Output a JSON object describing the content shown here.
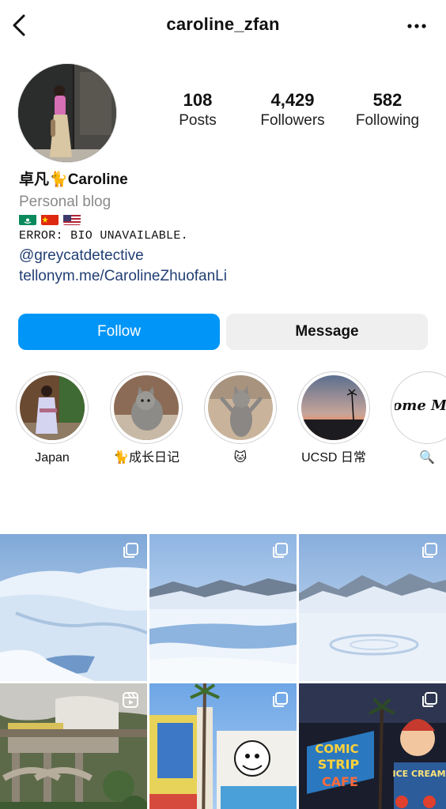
{
  "header": {
    "username": "caroline_zfan",
    "back_icon": "chevron-left-icon",
    "more_icon": "more-horizontal-icon"
  },
  "profile": {
    "stats": [
      {
        "value": "108",
        "label": "Posts"
      },
      {
        "value": "4,429",
        "label": "Followers"
      },
      {
        "value": "582",
        "label": "Following"
      }
    ],
    "display_name_prefix": "卓凡",
    "display_name_emoji": "🐈",
    "display_name_suffix": "Caroline",
    "category": "Personal blog",
    "flags": [
      "macau-flag",
      "china-flag",
      "usa-flag"
    ],
    "bio": "ERROR: BIO UNAVAILABLE.",
    "mention": "@greycatdetective",
    "website": "tellonym.me/CarolineZhuofanLi"
  },
  "actions": {
    "follow_label": "Follow",
    "message_label": "Message",
    "follow_color": "#0095f6"
  },
  "highlights": [
    {
      "label": "Japan"
    },
    {
      "label": "🐈成长日记"
    },
    {
      "label": "🐱"
    },
    {
      "label": "UCSD 日常"
    },
    {
      "label": "🔍"
    }
  ],
  "highlight_5_image_text": "Home Made",
  "posts": [
    {
      "type": "carousel",
      "scene": "snowy glacier"
    },
    {
      "type": "carousel",
      "scene": "snowy lake and mountains"
    },
    {
      "type": "carousel",
      "scene": "frozen lake and mountains"
    },
    {
      "type": "reel",
      "scene": "model railway viaduct"
    },
    {
      "type": "carousel",
      "scene": "cartoon storefront"
    },
    {
      "type": "carousel",
      "scene": "comic strip cafe sign"
    }
  ],
  "tile_6_sign": {
    "line1": "COMIC",
    "line2": "STRIP",
    "line3": "CAFE",
    "side": "ICE CREAM"
  }
}
